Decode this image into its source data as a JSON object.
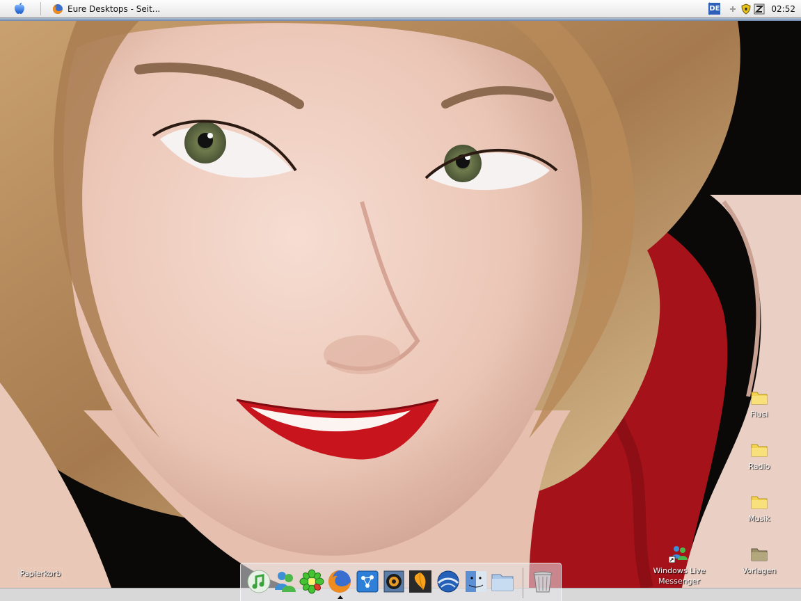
{
  "menubar": {
    "active_task": {
      "title": "Eure Desktops - Seit...",
      "icon": "firefox-icon"
    },
    "tray": {
      "language": "DE",
      "clock": "02:52",
      "icons": [
        "plus-icon",
        "shield-icon",
        "zonealarm-icon"
      ]
    }
  },
  "desktop": {
    "wallpaper": "portrait-photo-woman-red-lips",
    "icons": [
      {
        "label": "Flusi",
        "icon": "folder-icon"
      },
      {
        "label": "Radio",
        "icon": "folder-icon"
      },
      {
        "label": "Musik",
        "icon": "folder-icon"
      },
      {
        "label": "Vorlagen",
        "icon": "folder-icon-gray"
      },
      {
        "label": "Windows Live Messenger",
        "icon": "messenger-shortcut-icon"
      }
    ],
    "trash_label": "Papierkorb"
  },
  "dock": {
    "items": [
      {
        "name": "itunes-icon",
        "running": false
      },
      {
        "name": "messenger-icon",
        "running": false
      },
      {
        "name": "icq-icon",
        "running": false
      },
      {
        "name": "firefox-icon",
        "running": true
      },
      {
        "name": "network-icon",
        "running": false
      },
      {
        "name": "media-player-icon",
        "running": false
      },
      {
        "name": "fl-studio-icon",
        "running": false
      },
      {
        "name": "google-earth-icon",
        "running": false
      },
      {
        "name": "finder-icon",
        "running": false
      },
      {
        "name": "folder-icon",
        "running": false
      }
    ],
    "trash": "trash-icon"
  },
  "colors": {
    "menubar_accent": "#6f88ab",
    "folder": "#f2d24e",
    "lips": "#c8141c",
    "dress": "#a5121a"
  }
}
